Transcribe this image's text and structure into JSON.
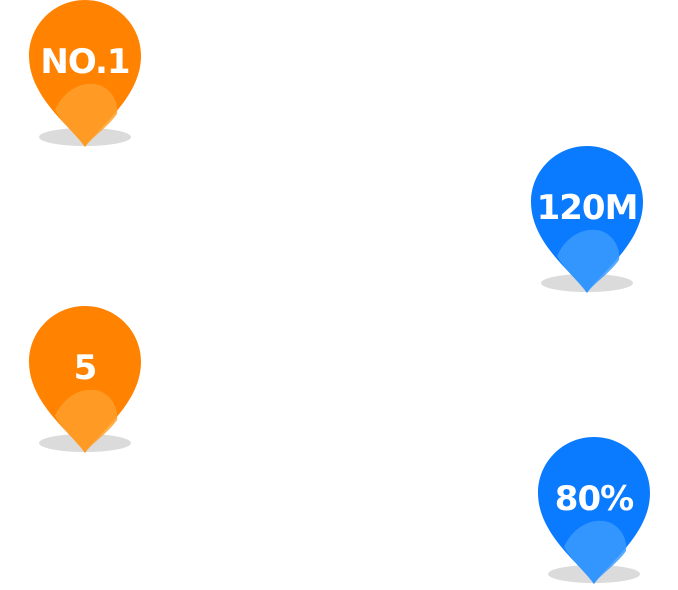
{
  "colors": {
    "orange": "#FF8200",
    "orange_light": "#FFA02A",
    "blue": "#0A7BFF",
    "blue_light": "#3B9BFF",
    "shadow": "#BDBDBD"
  },
  "pins": [
    {
      "label": "NO.1",
      "color": "orange"
    },
    {
      "label": "120M",
      "color": "blue"
    },
    {
      "label": "5",
      "color": "orange"
    },
    {
      "label": "80%",
      "color": "blue"
    }
  ]
}
